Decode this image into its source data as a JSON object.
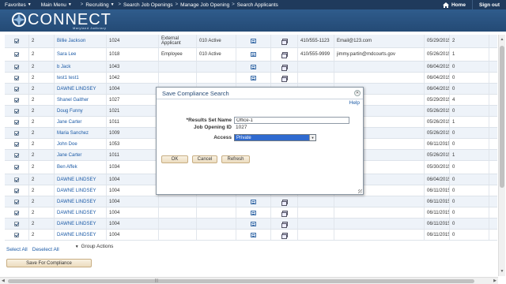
{
  "nav": {
    "favorites": "Favorites",
    "main_menu": "Main Menu",
    "breadcrumb": [
      "Recruiting",
      "Search Job Openings",
      "Manage Job Opening",
      "Search Applicants"
    ],
    "home": "Home",
    "sign_out": "Sign out"
  },
  "brand": {
    "name": "CONNECT",
    "tagline": "Maryland Judiciary"
  },
  "rows": [
    {
      "num": "2",
      "name": "Billie Jackson",
      "id": "1024",
      "type": "External Applicant",
      "status": "010 Active",
      "phone": "410/555-1123",
      "email": "Email@123.com",
      "date": "05/29/2015",
      "count": "2"
    },
    {
      "num": "2",
      "name": "Sara Lee",
      "id": "1018",
      "type": "Employee",
      "status": "010 Active",
      "phone": "410/555-9999",
      "email": "jimmy.partin@mdcourts.gov",
      "date": "05/26/2015",
      "count": "1"
    },
    {
      "num": "2",
      "name": "b Jack",
      "id": "1043",
      "type": "",
      "status": "",
      "phone": "",
      "email": "",
      "date": "06/04/2015",
      "count": "0"
    },
    {
      "num": "2",
      "name": "test1 test1",
      "id": "1042",
      "type": "",
      "status": "",
      "phone": "",
      "email": "",
      "date": "06/04/2015",
      "count": "0"
    },
    {
      "num": "2",
      "name": "DAWNE LINDSEY",
      "id": "1004",
      "type": "",
      "status": "",
      "phone": "",
      "email": "",
      "date": "06/04/2015",
      "count": "0"
    },
    {
      "num": "2",
      "name": "Shanel Gaither",
      "id": "1027",
      "type": "",
      "status": "",
      "phone": "",
      "email": "dcourts.gov",
      "date": "05/29/2015",
      "count": "4"
    },
    {
      "num": "2",
      "name": "Doug Funny",
      "id": "1021",
      "type": "",
      "status": "",
      "phone": "",
      "email": "dcourts.gov",
      "date": "05/26/2015",
      "count": "0"
    },
    {
      "num": "2",
      "name": "Jane Carter",
      "id": "1011",
      "type": "",
      "status": "",
      "phone": "",
      "email": "dcourts.gov",
      "date": "05/26/2015",
      "count": "1"
    },
    {
      "num": "2",
      "name": "Maria Sanchez",
      "id": "1009",
      "type": "",
      "status": "",
      "phone": "",
      "email": "dcourts.gov",
      "date": "05/26/2015",
      "count": "0"
    },
    {
      "num": "2",
      "name": "John Doe",
      "id": "1053",
      "type": "",
      "status": "",
      "phone": "",
      "email": "",
      "date": "06/11/2015",
      "count": "0"
    },
    {
      "num": "2",
      "name": "Jane Carter",
      "id": "1011",
      "type": "",
      "status": "",
      "phone": "",
      "email": "dcourts.gov",
      "date": "05/26/2015",
      "count": "1"
    },
    {
      "num": "2",
      "name": "Ben Affek",
      "id": "1034",
      "type": "",
      "status": "",
      "phone": "",
      "email": "om",
      "date": "05/30/2015",
      "count": "0"
    },
    {
      "num": "2",
      "name": "DAWNE LINDSEY",
      "id": "1004",
      "type": "",
      "status": "",
      "phone": "",
      "email": "",
      "date": "06/04/2015",
      "count": "0"
    },
    {
      "num": "2",
      "name": "DAWNE LINDSEY",
      "id": "1004",
      "type": "",
      "status": "",
      "phone": "",
      "email": "",
      "date": "06/11/2015",
      "count": "0"
    },
    {
      "num": "2",
      "name": "DAWNE LINDSEY",
      "id": "1004",
      "type": "",
      "status": "",
      "phone": "",
      "email": "",
      "date": "06/11/2015",
      "count": "0"
    },
    {
      "num": "2",
      "name": "DAWNE LINDSEY",
      "id": "1004",
      "type": "",
      "status": "",
      "phone": "",
      "email": "",
      "date": "06/11/2015",
      "count": "0"
    },
    {
      "num": "2",
      "name": "DAWNE LINDSEY",
      "id": "1004",
      "type": "",
      "status": "",
      "phone": "",
      "email": "",
      "date": "06/11/2015",
      "count": "0"
    },
    {
      "num": "2",
      "name": "DAWNE LINDSEY",
      "id": "1004",
      "type": "",
      "status": "",
      "phone": "",
      "email": "",
      "date": "06/11/2015",
      "count": "0"
    }
  ],
  "footer": {
    "select_all": "Select All",
    "deselect_all": "Deselect All",
    "group_actions": "Group Actions",
    "save_for_compliance": "Save For Compliance"
  },
  "modal": {
    "title": "Save Compliance Search",
    "help": "Help",
    "results_label": "*Results Set Name",
    "results_value": "Office-1",
    "job_opening_label": "Job Opening ID",
    "job_opening_value": "1027",
    "access_label": "Access",
    "access_value": "Private",
    "ok": "OK",
    "cancel": "Cancel",
    "refresh": "Refresh"
  },
  "icons": {
    "close": "close-icon",
    "home": "home-icon",
    "view": "document-icon",
    "attachments": "stack-icon"
  }
}
